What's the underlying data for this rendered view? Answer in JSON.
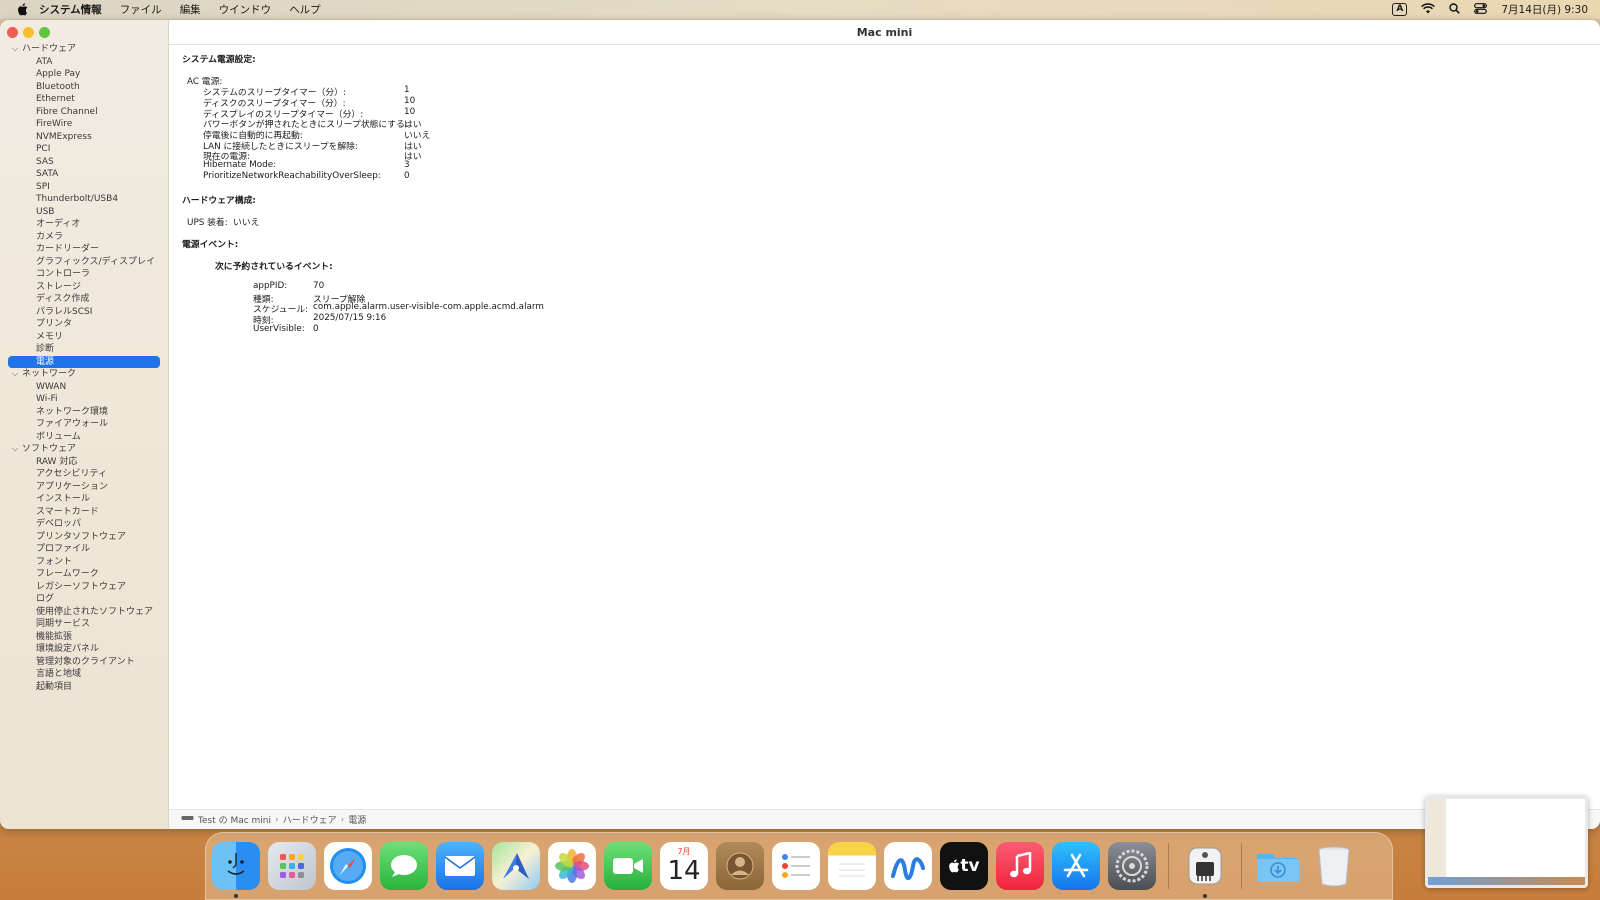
{
  "menubar": {
    "app_name": "システム情報",
    "items": [
      "ファイル",
      "編集",
      "ウインドウ",
      "ヘルプ"
    ],
    "ime": "A",
    "clock": "7月14日(月) 9:30"
  },
  "window": {
    "title": "Mac mini"
  },
  "sidebar": {
    "sections": [
      {
        "label": "ハードウェア",
        "items": [
          "ATA",
          "Apple Pay",
          "Bluetooth",
          "Ethernet",
          "Fibre Channel",
          "FireWire",
          "NVMExpress",
          "PCI",
          "SAS",
          "SATA",
          "SPI",
          "Thunderbolt/USB4",
          "USB",
          "オーディオ",
          "カメラ",
          "カードリーダー",
          "グラフィックス/ディスプレイ",
          "コントローラ",
          "ストレージ",
          "ディスク作成",
          "パラレルSCSI",
          "プリンタ",
          "メモリ",
          "診断",
          "電源"
        ]
      },
      {
        "label": "ネットワーク",
        "items": [
          "WWAN",
          "Wi-Fi",
          "ネットワーク環境",
          "ファイアウォール",
          "ボリューム"
        ]
      },
      {
        "label": "ソフトウェア",
        "items": [
          "RAW 対応",
          "アクセシビリティ",
          "アプリケーション",
          "インストール",
          "スマートカード",
          "デベロッパ",
          "プリンタソフトウェア",
          "プロファイル",
          "フォント",
          "フレームワーク",
          "レガシーソフトウェア",
          "ログ",
          "使用停止されたソフトウェア",
          "同期サービス",
          "機能拡張",
          "環境設定パネル",
          "管理対象のクライアント",
          "言語と地域",
          "起動項目"
        ]
      }
    ],
    "selected": "電源"
  },
  "detail": {
    "power_settings_heading": "システム電源設定:",
    "ac_power_label": "AC 電源:",
    "ac_rows": [
      {
        "key": "システムのスリープタイマー（分）:",
        "value": "1"
      },
      {
        "key": "ディスクのスリープタイマー（分）:",
        "value": "10"
      },
      {
        "key": "ディスプレイのスリープタイマー（分）:",
        "value": "10"
      },
      {
        "key": "パワーボタンが押されたときにスリープ状態にする:",
        "value": "はい"
      },
      {
        "key": "停電後に自動的に再起動:",
        "value": "いいえ"
      },
      {
        "key": "LAN に接続したときにスリープを解除:",
        "value": "はい"
      },
      {
        "key": "現在の電源:",
        "value": "はい"
      },
      {
        "key": "Hibernate Mode:",
        "value": "3"
      },
      {
        "key": "PrioritizeNetworkReachabilityOverSleep:",
        "value": "0"
      }
    ],
    "hardware_heading": "ハードウェア構成:",
    "ups_key": "UPS 装着:",
    "ups_value": "いいえ",
    "events_heading": "電源イベント:",
    "next_event_heading": "次に予約されているイベント:",
    "event_rows": [
      {
        "key": "appPID:",
        "value": "70"
      },
      {
        "key": "種類:",
        "value": "スリープ解除"
      },
      {
        "key": "スケジュール:",
        "value": "com.apple.alarm.user-visible-com.apple.acmd.alarm"
      },
      {
        "key": "時刻:",
        "value": "2025/07/15 9:16"
      },
      {
        "key": "UserVisible:",
        "value": "0"
      }
    ]
  },
  "pathbar": {
    "computer": "Test の Mac mini",
    "category": "ハードウェア",
    "item": "電源"
  },
  "dock": {
    "calendar_month": "7月",
    "calendar_day": "14",
    "tv_label": "tv"
  },
  "colors": {
    "accent": "#1e73e8"
  }
}
